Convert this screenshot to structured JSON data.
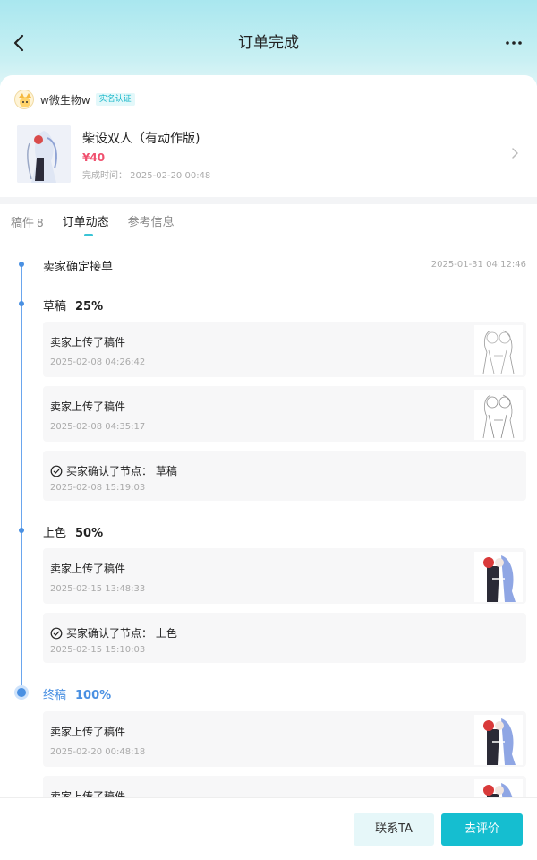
{
  "header": {
    "title": "订单完成",
    "back_icon": "chevron-left-icon",
    "more_icon": "more-horizontal-icon"
  },
  "order": {
    "seller_name": "w微生物w",
    "verify_badge": "实名认证",
    "product_title": "柴设双人（有动作版)",
    "price": "¥40",
    "complete_time": "完成时间： 2025-02-20 00:48"
  },
  "tabs": [
    {
      "label": "稿件",
      "count": "8"
    },
    {
      "label": "订单动态"
    },
    {
      "label": "参考信息"
    }
  ],
  "timeline": {
    "accepted": {
      "title": "卖家确定接单",
      "time": "2025-01-31 04:12:46"
    },
    "draft": {
      "title": "草稿",
      "pct": "25%",
      "records": [
        {
          "text": "卖家上传了稿件",
          "time": "2025-02-08 04:26:42"
        },
        {
          "text": "卖家上传了稿件",
          "time": "2025-02-08 04:35:17"
        },
        {
          "text": "买家确认了节点： 草稿",
          "time": "2025-02-08 15:19:03"
        }
      ]
    },
    "color": {
      "title": "上色",
      "pct": "50%",
      "records": [
        {
          "text": "卖家上传了稿件",
          "time": "2025-02-15 13:48:33"
        },
        {
          "text": "买家确认了节点： 上色",
          "time": "2025-02-15 15:10:03"
        }
      ]
    },
    "final": {
      "title": "终稿",
      "pct": "100%",
      "records": [
        {
          "text": "卖家上传了稿件",
          "time": "2025-02-20 00:48:18"
        },
        {
          "text": "卖家上传了稿件"
        }
      ]
    }
  },
  "actions": {
    "contact": "联系TA",
    "review": "去评价"
  },
  "colors": {
    "accent": "#15bed0",
    "price": "#f0506e",
    "timeline": "#4a90e2"
  }
}
